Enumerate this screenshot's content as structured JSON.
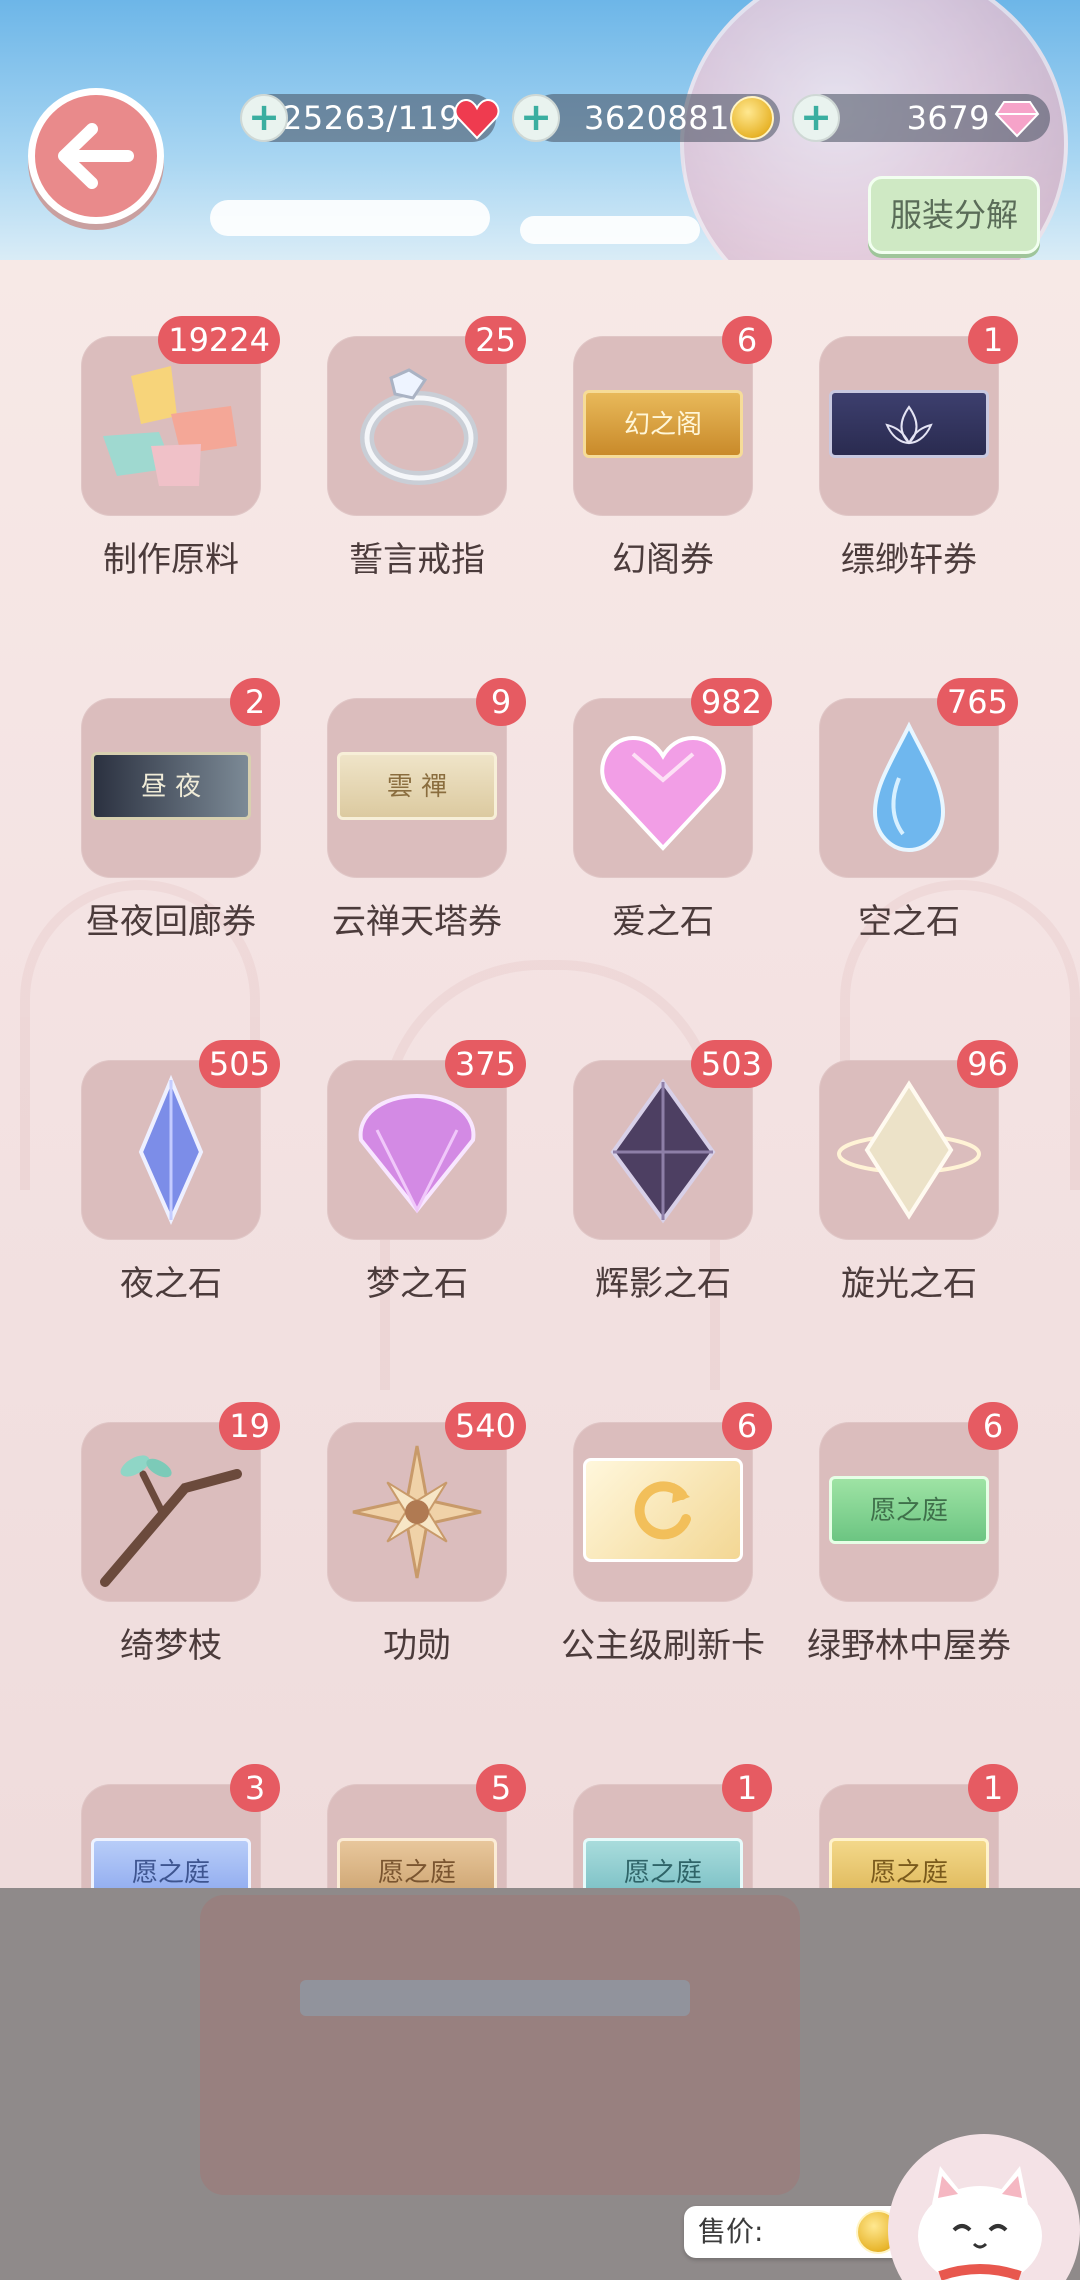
{
  "header": {
    "resources": [
      {
        "name": "stamina",
        "value": "25263/119",
        "icon": "heart-icon"
      },
      {
        "name": "gold",
        "value": "3620881",
        "icon": "coin-icon"
      },
      {
        "name": "diamonds",
        "value": "3679",
        "icon": "diamond-icon"
      }
    ],
    "decompose_label": "服装分解"
  },
  "items": [
    {
      "label": "制作原料",
      "count": "19224",
      "icon": "paper-scraps-icon"
    },
    {
      "label": "誓言戒指",
      "count": "25",
      "icon": "ring-icon"
    },
    {
      "label": "幻阁券",
      "count": "6",
      "icon": "ticket-icon",
      "ticket_text": "幻之阁"
    },
    {
      "label": "缥缈轩券",
      "count": "1",
      "icon": "ticket-icon"
    },
    {
      "label": "昼夜回廊券",
      "count": "2",
      "icon": "ticket-icon",
      "ticket_text": "昼 夜"
    },
    {
      "label": "云禅天塔券",
      "count": "9",
      "icon": "ticket-icon",
      "ticket_text": "雲 禪"
    },
    {
      "label": "爱之石",
      "count": "982",
      "icon": "heart-gem-icon"
    },
    {
      "label": "空之石",
      "count": "765",
      "icon": "drop-gem-icon"
    },
    {
      "label": "夜之石",
      "count": "505",
      "icon": "blue-crystal-icon"
    },
    {
      "label": "梦之石",
      "count": "375",
      "icon": "purple-gem-icon"
    },
    {
      "label": "辉影之石",
      "count": "503",
      "icon": "dark-crystal-icon"
    },
    {
      "label": "旋光之石",
      "count": "96",
      "icon": "white-crystal-icon"
    },
    {
      "label": "绮梦枝",
      "count": "19",
      "icon": "branch-icon"
    },
    {
      "label": "功勋",
      "count": "540",
      "icon": "star-medal-icon"
    },
    {
      "label": "公主级刷新卡",
      "count": "6",
      "icon": "refresh-card-icon"
    },
    {
      "label": "绿野林中屋券",
      "count": "6",
      "icon": "ticket-icon",
      "ticket_text": "愿之庭"
    },
    {
      "label": "",
      "count": "3",
      "icon": "ticket-icon",
      "ticket_text": "愿之庭"
    },
    {
      "label": "",
      "count": "5",
      "icon": "ticket-icon",
      "ticket_text": "愿之庭"
    },
    {
      "label": "",
      "count": "1",
      "icon": "ticket-icon",
      "ticket_text": "愿之庭"
    },
    {
      "label": "",
      "count": "1",
      "icon": "ticket-icon",
      "ticket_text": "愿之庭"
    }
  ],
  "footer": {
    "sell_label": "售价:"
  },
  "colors": {
    "badge": "#e65b62",
    "tile": "#dbbdbd",
    "back_button": "#e98a8b",
    "decompose_button": "#cfe9c4"
  }
}
